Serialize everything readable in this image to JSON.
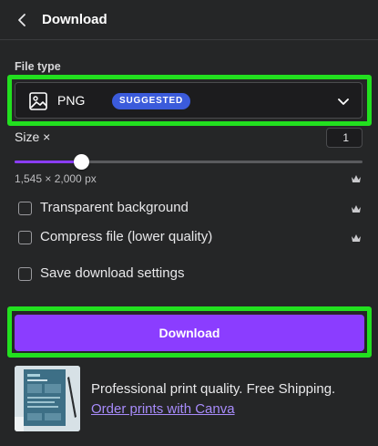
{
  "header": {
    "title": "Download",
    "back_icon": "chevron-left-icon"
  },
  "file_type": {
    "label": "File type",
    "value": "PNG",
    "badge": "SUGGESTED",
    "icon": "image-icon",
    "chevron_icon": "chevron-down-icon"
  },
  "size": {
    "label": "Size ×",
    "multiplier": "1",
    "slider_fraction": 0.19,
    "dimensions": "1,545 × 2,000 px",
    "premium_icon": "crown-icon"
  },
  "options": [
    {
      "label": "Transparent background",
      "checked": false,
      "premium": true
    },
    {
      "label": "Compress file (lower quality)",
      "checked": false,
      "premium": true
    },
    {
      "label": "Save download settings",
      "checked": false,
      "premium": false
    }
  ],
  "download_button": {
    "label": "Download"
  },
  "promo": {
    "text": "Professional print quality. Free Shipping.",
    "link": "Order prints with Canva"
  },
  "colors": {
    "background": "#252627",
    "accent_purple": "#8b3dff",
    "badge_blue": "#3b5bdb",
    "highlight_green": "#22e01f",
    "link": "#a78bfa"
  }
}
